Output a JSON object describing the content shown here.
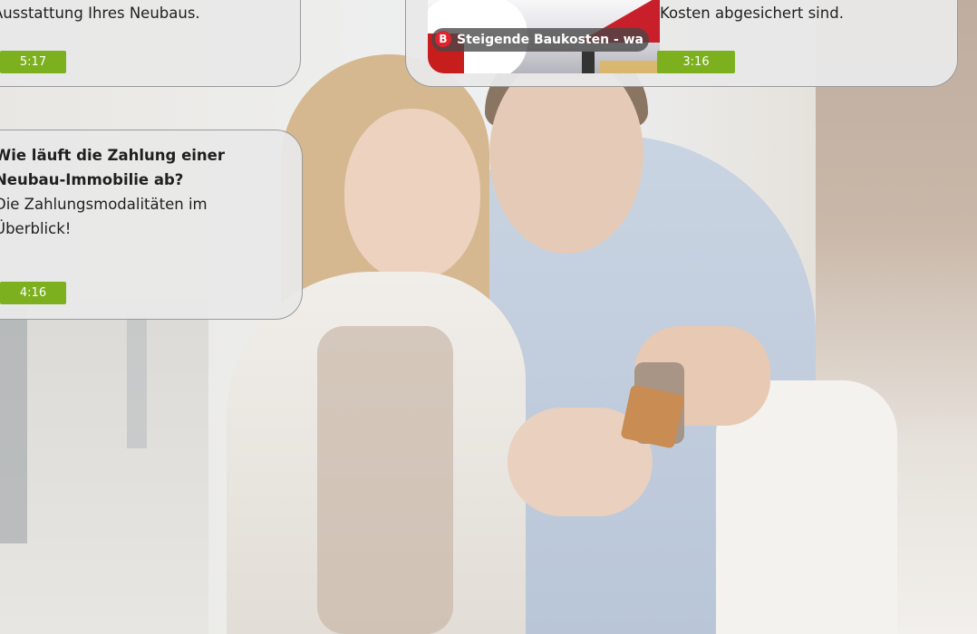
{
  "cards": [
    {
      "id": "card-a",
      "title": "",
      "text": "Ausstattung Ihres Neubaus.",
      "duration": "5:17"
    },
    {
      "id": "card-b",
      "text": "Kosten abgesichert sind.",
      "duration": "3:16",
      "thumbnail": {
        "brand_letter": "B",
        "caption": "Steigende Baukosten - wa"
      }
    },
    {
      "id": "card-c",
      "title_line1": "Wie läuft die Zahlung einer",
      "title_line2": "Neubau-Immobilie ab?",
      "text_line1": "Die Zahlungsmodalitäten im",
      "text_line2": "Überblick!",
      "duration": "4:16"
    }
  ],
  "colors": {
    "badge": "#7cb01f",
    "card_bg": "#e8e8e8",
    "brand_red": "#e0232e"
  }
}
